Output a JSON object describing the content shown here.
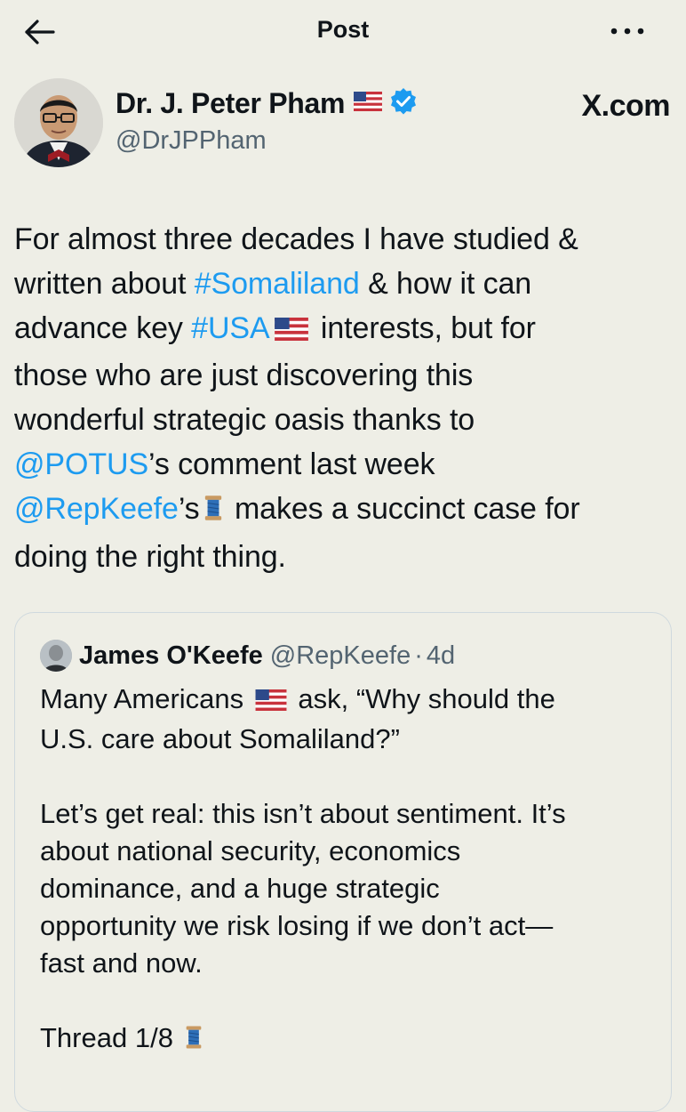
{
  "header": {
    "title": "Post"
  },
  "author": {
    "name": "Dr. J. Peter Pham",
    "handle": "@DrJPPham",
    "verified": true,
    "brand": "X.com"
  },
  "post": {
    "lines": [
      [
        {
          "t": "For almost three decades I have studied &"
        }
      ],
      [
        {
          "t": "written about "
        },
        {
          "t": "#Somaliland",
          "link": true
        },
        {
          "t": " & how it can"
        }
      ],
      [
        {
          "t": "advance key "
        },
        {
          "t": "#USA",
          "link": true
        },
        {
          "icon": "us-flag"
        },
        {
          "t": " interests, but for"
        }
      ],
      [
        {
          "t": "those who are just discovering this"
        }
      ],
      [
        {
          "t": "wonderful strategic oasis thanks to"
        }
      ],
      [
        {
          "t": "@POTUS",
          "link": true
        },
        {
          "t": "’s comment last week"
        }
      ],
      [
        {
          "t": "@RepKeefe",
          "link": true
        },
        {
          "t": "’s"
        },
        {
          "icon": "spool"
        },
        {
          "t": " makes a succinct case for"
        }
      ],
      [
        {
          "t": "doing the right thing."
        }
      ]
    ]
  },
  "quote": {
    "name": "James O'Keefe",
    "handle": "@RepKeefe",
    "separator": "·",
    "time": "4d",
    "lines": [
      [
        {
          "t": "Many Americans "
        },
        {
          "icon": "us-flag"
        },
        {
          "t": " ask, “Why should the"
        }
      ],
      [
        {
          "t": "U.S. care about Somaliland?”"
        }
      ],
      [],
      [
        {
          "t": "Let’s get real: this isn’t about sentiment. It’s"
        }
      ],
      [
        {
          "t": "about national security, economics"
        }
      ],
      [
        {
          "t": "dominance, and a huge strategic"
        }
      ],
      [
        {
          "t": "opportunity we risk losing if we don’t act—"
        }
      ],
      [
        {
          "t": "fast and now."
        }
      ],
      [],
      [
        {
          "t": "Thread 1/8 "
        },
        {
          "icon": "spool"
        }
      ]
    ]
  },
  "colors": {
    "background": "#eeeee6",
    "link": "#1d9bf0",
    "secondary": "#536471",
    "verified": "#1d9bf0"
  },
  "icons": {
    "back": "arrow-left-icon",
    "more": "more-horizontal-icon",
    "verified": "verified-badge-icon",
    "flag": "us-flag-icon",
    "spool": "thread-spool-icon"
  }
}
